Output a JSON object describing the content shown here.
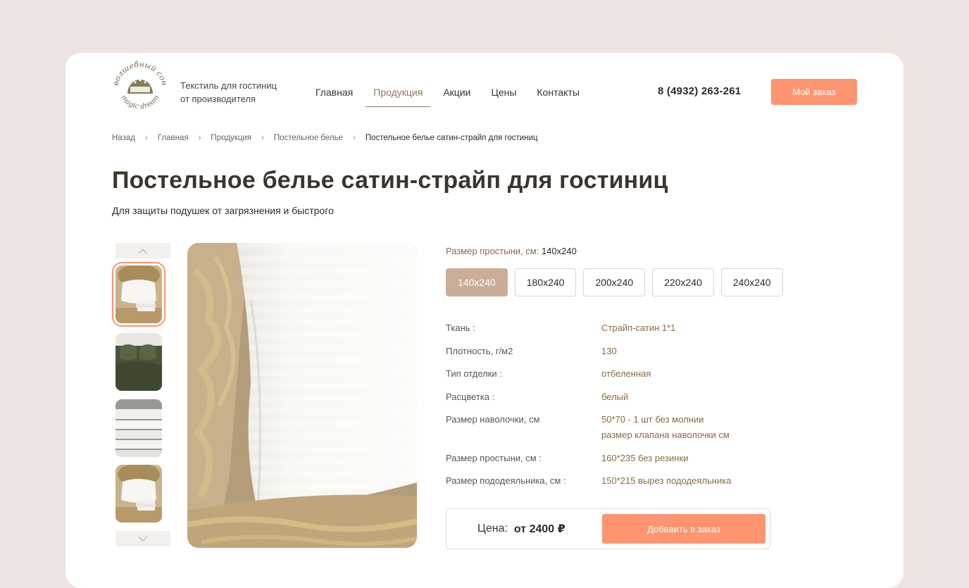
{
  "logo": {
    "arc_text_top": "волшебный сон",
    "arc_text_bottom": "magic dream"
  },
  "tagline": {
    "line1": "Текстиль для гостиниц",
    "line2": "от производителя"
  },
  "nav": [
    {
      "label": "Главная",
      "active": false
    },
    {
      "label": "Продукция",
      "active": true
    },
    {
      "label": "Акции",
      "active": false
    },
    {
      "label": "Цены",
      "active": false
    },
    {
      "label": "Контакты",
      "active": false
    }
  ],
  "phone": "8 (4932) 263-261",
  "order_button": "Мой заказ",
  "breadcrumb": {
    "items": [
      "Назад",
      "Главная",
      "Продукция",
      "Постельное белье"
    ],
    "current": "Постельное белье сатин-страйп для гостиниц",
    "separator": "›"
  },
  "product": {
    "title": "Постельное белье сатин-страйп для гостиниц",
    "subtitle": "Для защиты подушек от загрязнения и быстрого"
  },
  "gallery": {
    "up_icon": "chevron-up-icon",
    "down_icon": "chevron-down-icon",
    "thumbnails": [
      "pillow-on-gold-bed",
      "green-bedding",
      "stacked-white-linen",
      "pillow-on-gold-bed"
    ],
    "selected_index": 0
  },
  "size_selector": {
    "label": "Размер простыни, см:",
    "selected": "140x240",
    "options": [
      "140x240",
      "180x240",
      "200x240",
      "220x240",
      "240x240"
    ]
  },
  "specs": [
    {
      "key": "Ткань :",
      "value": "Страйп-сатин 1*1"
    },
    {
      "key": "Плотность, г/м2",
      "value": "130"
    },
    {
      "key": "Тип отделки :",
      "value": "отбеленная"
    },
    {
      "key": "Расцветка :",
      "value": "белый"
    },
    {
      "key": "Размер наволочки, см",
      "value": "50*70 - 1 шт без молнии",
      "value2": "размер клапана наволочки см"
    },
    {
      "key": "Размер простыни, см :",
      "value": "160*235 без резинки"
    },
    {
      "key": "Размер пододеяльника, см :",
      "value": "150*215 вырез пододеяльника"
    }
  ],
  "price": {
    "label": "Цена:",
    "value": "от 2400 ₽"
  },
  "add_button": "Добавить в заказ",
  "colors": {
    "accent": "#ff9470",
    "size_active": "#c9ad98",
    "spec_value": "#8a6a40",
    "background": "#ede3e0"
  }
}
